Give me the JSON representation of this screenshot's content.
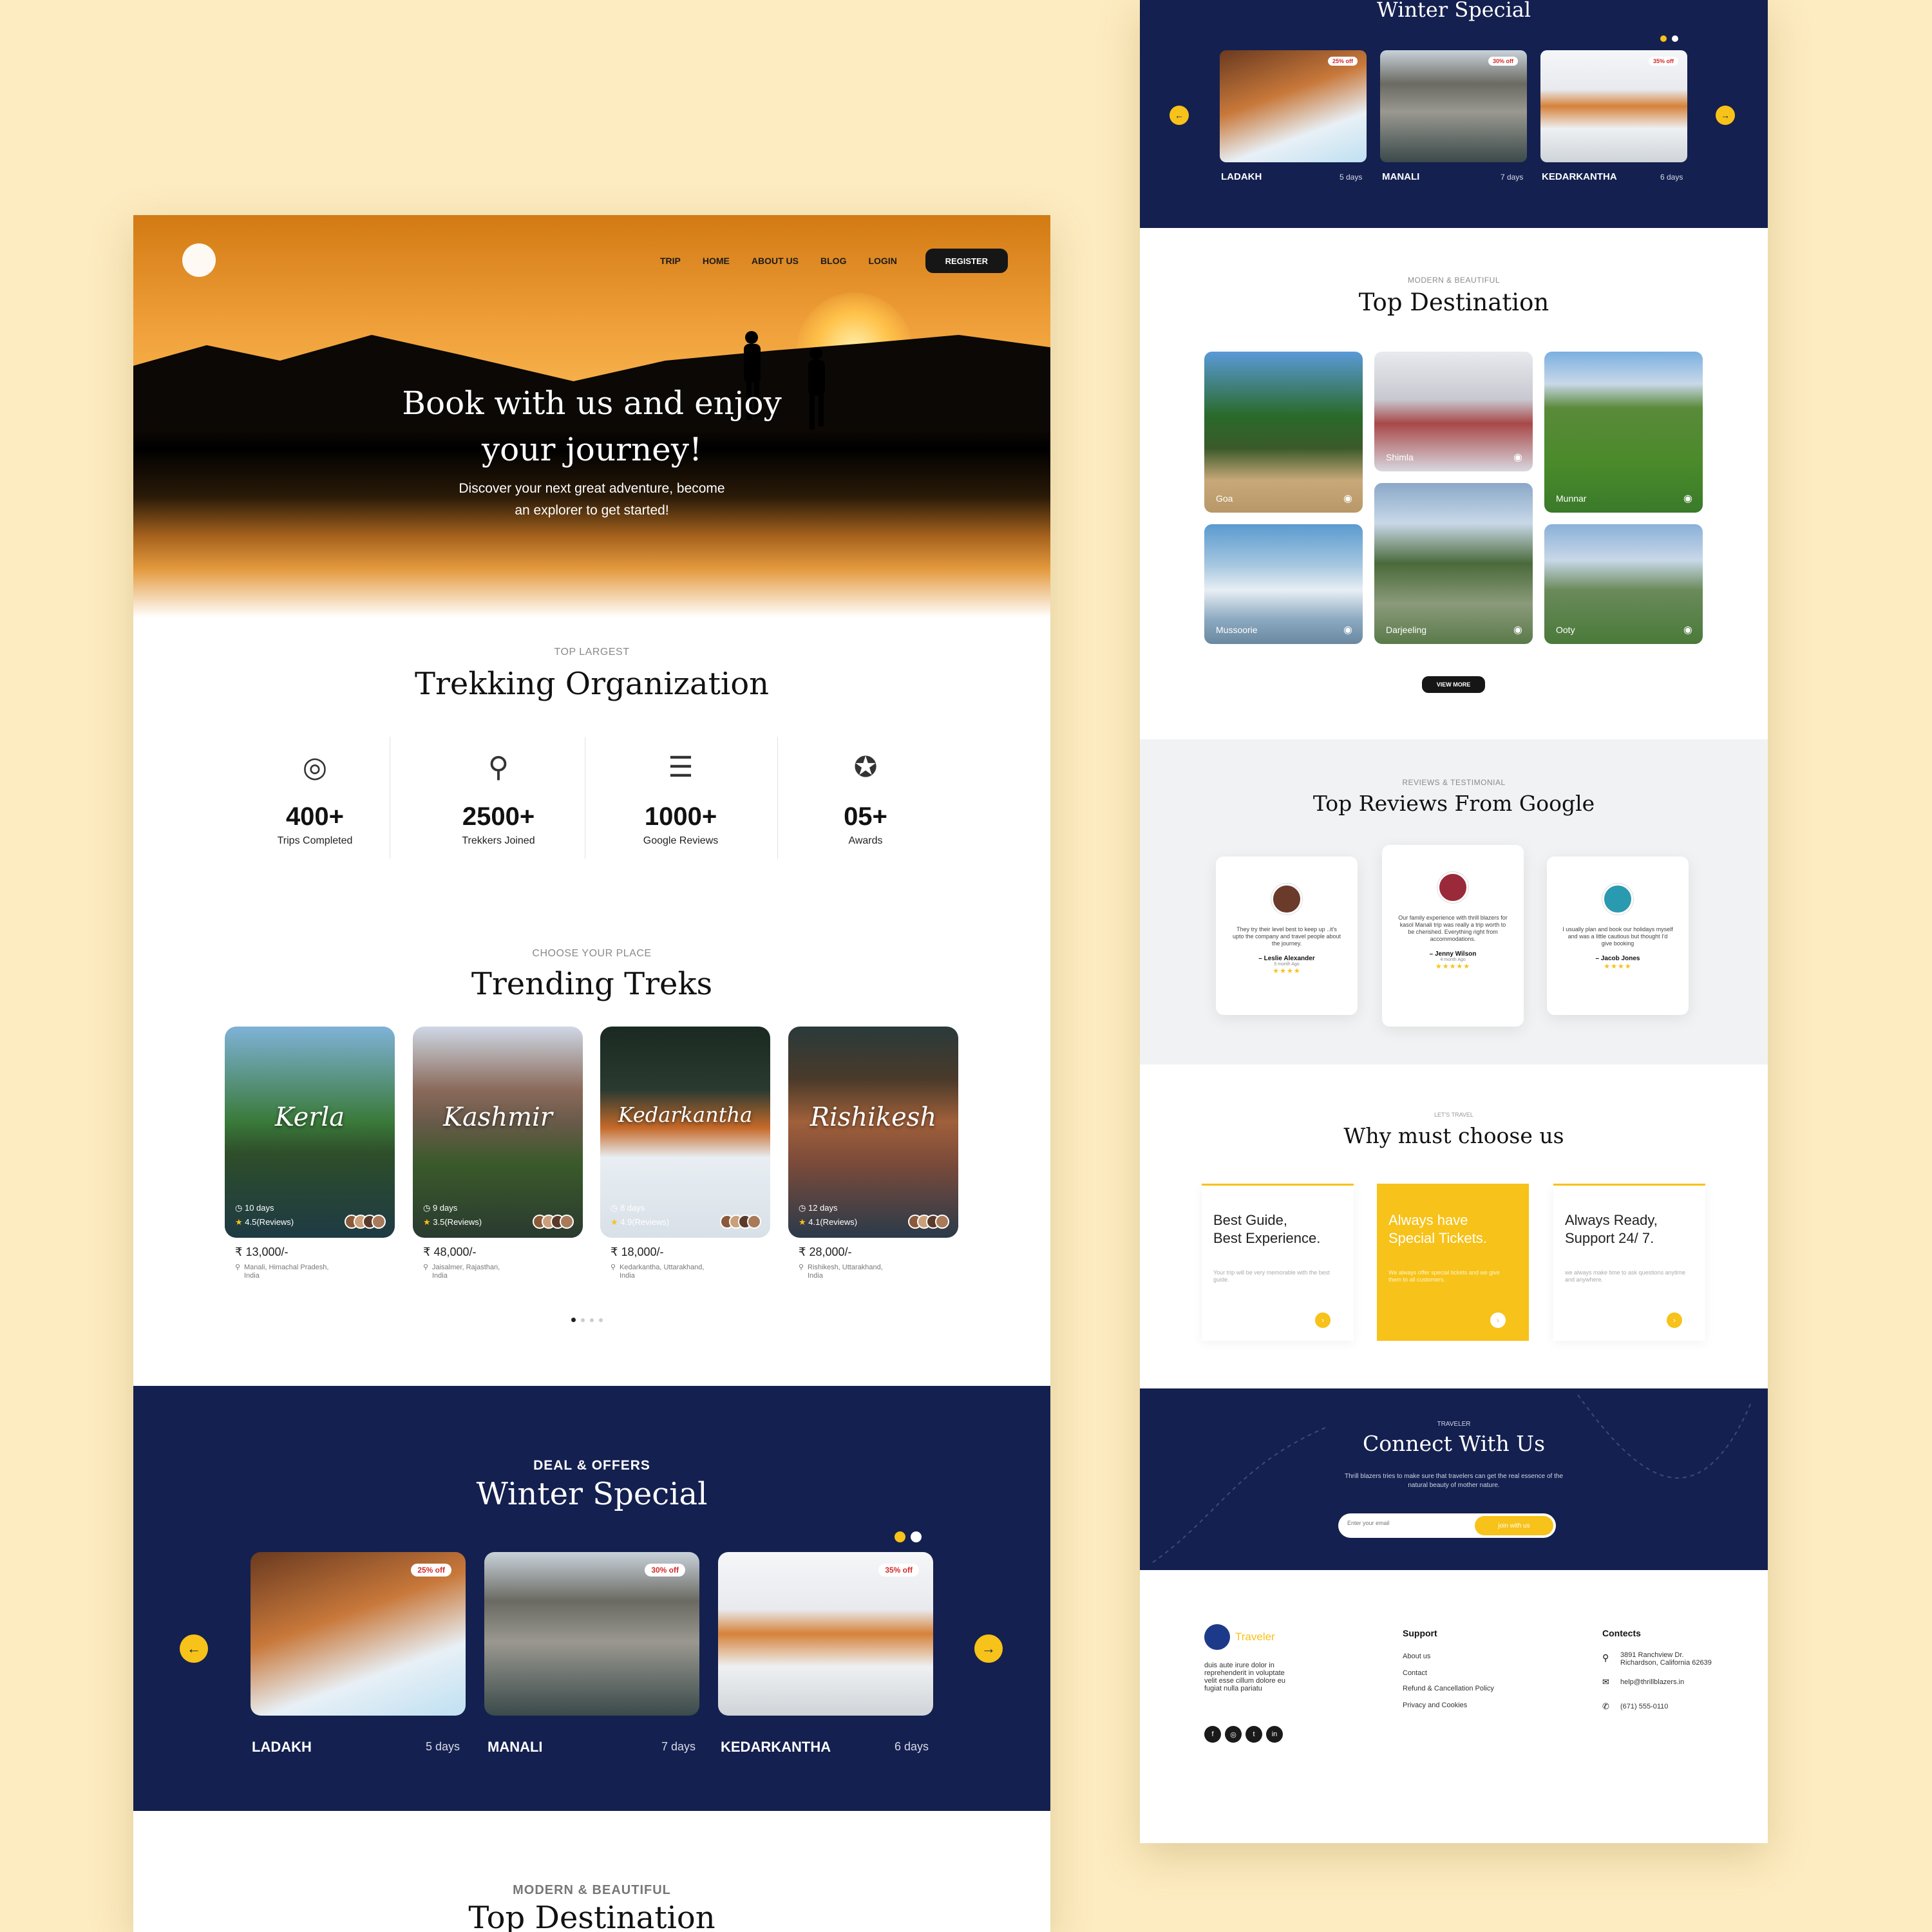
{
  "nav": {
    "items": [
      "TRIP",
      "HOME",
      "ABOUT US",
      "BLOG",
      "LOGIN"
    ],
    "register": "REGISTER"
  },
  "hero": {
    "title_line1": "Book with us and enjoy",
    "title_line2": "your journey!",
    "sub_line1": "Discover your next great adventure, become",
    "sub_line2": "an explorer to get started!"
  },
  "org": {
    "kicker": "TOP LARGEST",
    "title": "Trekking Organization",
    "stats": [
      {
        "num": "400+",
        "label": "Trips Completed",
        "icon": "globe-icon"
      },
      {
        "num": "2500+",
        "label": "Trekkers Joined",
        "icon": "hiker-icon"
      },
      {
        "num": "1000+",
        "label": "Google Reviews",
        "icon": "reviews-icon"
      },
      {
        "num": "05+",
        "label": "Awards",
        "icon": "award-icon"
      }
    ]
  },
  "treks": {
    "kicker": "CHOOSE YOUR PLACE",
    "title": "Trending Treks",
    "items": [
      {
        "name": "Kerla",
        "days": "10 days",
        "rating": "4.5(Reviews)",
        "price": "₹ 13,000/-",
        "loc1": "Manali, Himachal Pradesh,",
        "loc2": "India"
      },
      {
        "name": "Kashmir",
        "days": "9 days",
        "rating": "3.5(Reviews)",
        "price": "₹ 48,000/-",
        "loc1": "Jaisalmer, Rajasthan,",
        "loc2": "India"
      },
      {
        "name": "Kedarkantha",
        "days": "8 days",
        "rating": "4.9(Reviews)",
        "price": "₹ 18,000/-",
        "loc1": "Kedarkantha, Uttarakhand,",
        "loc2": "India"
      },
      {
        "name": "Rishikesh",
        "days": "12 days",
        "rating": "4.1(Reviews)",
        "price": "₹ 28,000/-",
        "loc1": "Rishikesh, Uttarakhand,",
        "loc2": "India"
      }
    ]
  },
  "deals": {
    "kicker": "DEAL & OFFERS",
    "title": "Winter Special",
    "items": [
      {
        "name": "LADAKH",
        "days": "5 days",
        "badge": "25% off"
      },
      {
        "name": "MANALI",
        "days": "7 days",
        "badge": "30% off"
      },
      {
        "name": "KEDARKANTHA",
        "days": "6 days",
        "badge": "35% off"
      }
    ]
  },
  "dest": {
    "kicker": "MODERN & BEAUTIFUL",
    "title": "Top Destination",
    "items": [
      "Goa",
      "Shimla",
      "Munnar",
      "Mussoorie",
      "Darjeeling",
      "Ooty"
    ],
    "more": "VIEW MORE"
  },
  "reviews": {
    "kicker": "REVIEWS & TESTIMONIAL",
    "title": "Top Reviews From Google",
    "items": [
      {
        "q": "They try their level best to keep up ..it's upto the company and travel people about the journey.",
        "who": "– Leslie Alexander",
        "ago": "5 month Ago",
        "stars": "★★★★"
      },
      {
        "q": "Our family experience with thrill blazers for kasol Manali trip was really a trip worth to be cherished. Everything right from accommodations.",
        "who": "– Jenny Wilson",
        "ago": "4 month Ago",
        "stars": "★★★★★"
      },
      {
        "q": "I usually plan and book our holidays myself and was a little cautious but thought I'd give booking",
        "who": "– Jacob Jones",
        "ago": "",
        "stars": "★★★★"
      }
    ]
  },
  "why": {
    "kicker": "LET'S TRAVEL",
    "title": "Why must choose us",
    "items": [
      {
        "t1": "Best Guide,",
        "t2": "Best Experience.",
        "s": "Your trip will be very memorable with the best guide."
      },
      {
        "t1": "Always have",
        "t2": "Special Tickets.",
        "s": "We always offer special tickets and we give them to all customers."
      },
      {
        "t1": "Always Ready,",
        "t2": "Support 24/ 7.",
        "s": "we always make time to ask questions anytime and anywhere."
      }
    ]
  },
  "connect": {
    "kicker": "TRAVELER",
    "title": "Connect With Us",
    "text1": "Thrill blazers tries to make sure that travelers can get the real essence of the",
    "text2": "natural beauty of mother nature.",
    "placeholder": "Enter your email",
    "button": "join with us"
  },
  "footer": {
    "brand": "Traveler",
    "about": [
      "duis aute irure dolor in",
      "reprehenderit in voluptate",
      "velit esse cillum dolore eu",
      "fugiat nulla pariatu"
    ],
    "support_title": "Support",
    "support": [
      "About us",
      "Contact",
      "Refund & Cancellation Policy",
      "Privacy and Cookies"
    ],
    "contacts_title": "Contects",
    "addr1": "3891 Ranchview Dr.",
    "addr2": "Richardson, California 62639",
    "email": "help@thrillblazers.in",
    "phone": "(671) 555-0110"
  },
  "colors": {
    "navy": "#14204f",
    "accent": "#f7c219",
    "background": "#fdecc1"
  }
}
